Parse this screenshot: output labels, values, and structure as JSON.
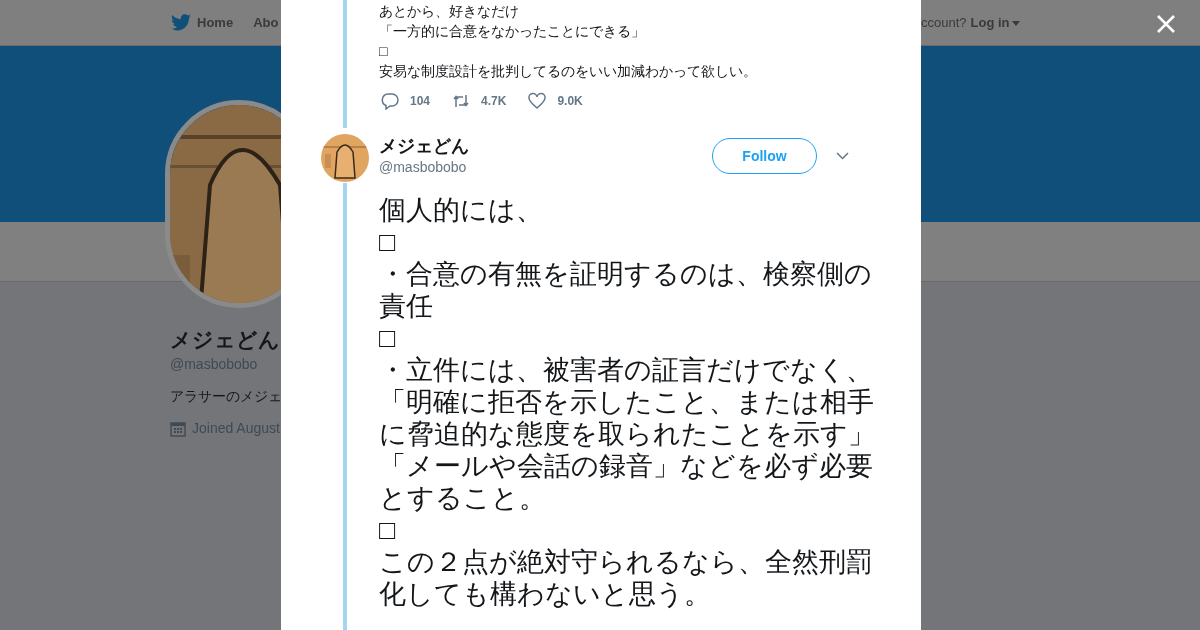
{
  "background_page": {
    "nav": {
      "items": [
        "Home",
        "Abo"
      ],
      "login_prompt": "ccount?",
      "login": "Log in"
    },
    "profile": {
      "name": "メジェどん",
      "handle": "@masbobobo",
      "bio": "アラサーのメジェ",
      "joined": "Joined August"
    }
  },
  "previous_tweet": {
    "lines": [
      "あとから、好きなだけ",
      "「一方的に合意をなかったことにできる」",
      "□",
      "安易な制度設計を批判してるのをいい加減わかって欲しい。"
    ],
    "actions": [
      {
        "kind": "reply",
        "count": "104"
      },
      {
        "kind": "retweet",
        "count": "4.7K"
      },
      {
        "kind": "like",
        "count": "9.0K"
      }
    ]
  },
  "tweet": {
    "name": "メジェどん",
    "handle": "@masbobobo",
    "follow": "Follow",
    "text": "個人的には、\n□\n・合意の有無を証明するのは、検察側の責任\n□\n・立件には、被害者の証言だけでなく、「明確に拒否を示したこと、または相手に脅迫的な態度を取られたことを示す」「メールや会話の録音」などを必ず必要とすること。\n□\nこの２点が絶対守られるなら、全然刑罰化しても構わないと思う。"
  }
}
